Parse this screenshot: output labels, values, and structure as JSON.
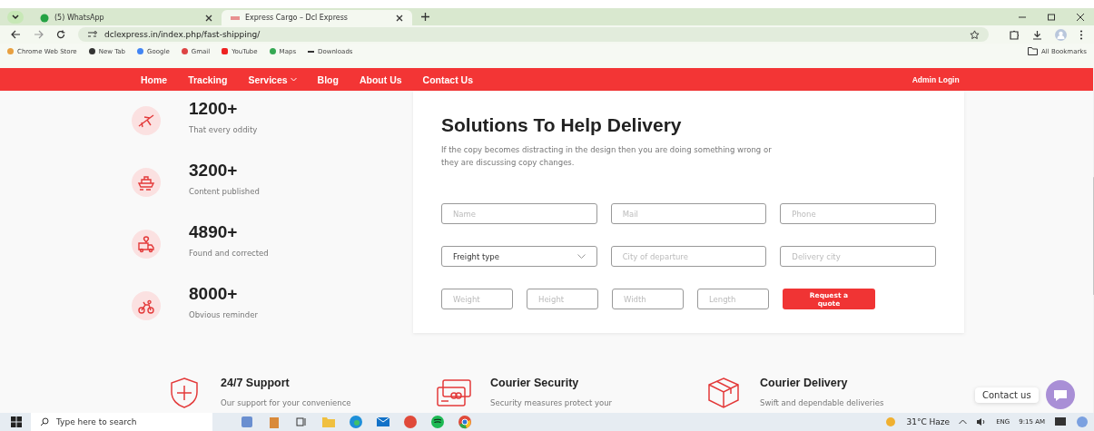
{
  "browser": {
    "tabs": [
      {
        "title": "(5) WhatsApp",
        "selected": false
      },
      {
        "title": "Express Cargo – Dcl Express",
        "selected": true
      }
    ],
    "url": "dclexpress.in/index.php/fast-shipping/",
    "bookmarks": [
      "Chrome Web Store",
      "New Tab",
      "Google",
      "Gmail",
      "YouTube",
      "Maps",
      "Downloads"
    ],
    "all_bookmarks": "All Bookmarks"
  },
  "nav": {
    "items": [
      {
        "label": "Home",
        "dropdown": false
      },
      {
        "label": "Tracking",
        "dropdown": false
      },
      {
        "label": "Services",
        "dropdown": true
      },
      {
        "label": "Blog",
        "dropdown": false
      },
      {
        "label": "About Us",
        "dropdown": false
      },
      {
        "label": "Contact Us",
        "dropdown": false
      }
    ],
    "admin_login": "Admin Login"
  },
  "stats": [
    {
      "value": "1200+",
      "caption": "That every oddity",
      "kind": "plane"
    },
    {
      "value": "3200+",
      "caption": "Content published",
      "kind": "ship"
    },
    {
      "value": "4890+",
      "caption": "Found and corrected",
      "kind": "truck"
    },
    {
      "value": "8000+",
      "caption": "Obvious reminder",
      "kind": "bike"
    }
  ],
  "form": {
    "title": "Solutions To Help Delivery",
    "description": "If the copy becomes distracting in the design then you are doing something wrong or they are discussing copy changes.",
    "rows": [
      [
        {
          "kind": "input",
          "placeholder": "Name"
        },
        {
          "kind": "input",
          "placeholder": "Mail"
        },
        {
          "kind": "input",
          "placeholder": "Phone"
        }
      ],
      [
        {
          "kind": "select",
          "value": "Freight type"
        },
        {
          "kind": "input",
          "placeholder": "City of departure"
        },
        {
          "kind": "input",
          "placeholder": "Delivery city"
        }
      ]
    ],
    "measurements": [
      {
        "placeholder": "Weight"
      },
      {
        "placeholder": "Height"
      },
      {
        "placeholder": "Width"
      },
      {
        "placeholder": "Length"
      }
    ],
    "button": "Request a quote"
  },
  "features": [
    {
      "title": "24/7 Support",
      "text": "Our support for your convenience",
      "kind": "shield"
    },
    {
      "title": "Courier Security",
      "text": "Security measures protect your",
      "kind": "card"
    },
    {
      "title": "Courier Delivery",
      "text": "Swift and dependable deliveries",
      "kind": "box"
    }
  ],
  "contact_label": "Contact us",
  "taskbar": {
    "search_placeholder": "Type here to search",
    "weather": "31°C Haze",
    "language": "ENG",
    "time": "9:15 AM"
  }
}
